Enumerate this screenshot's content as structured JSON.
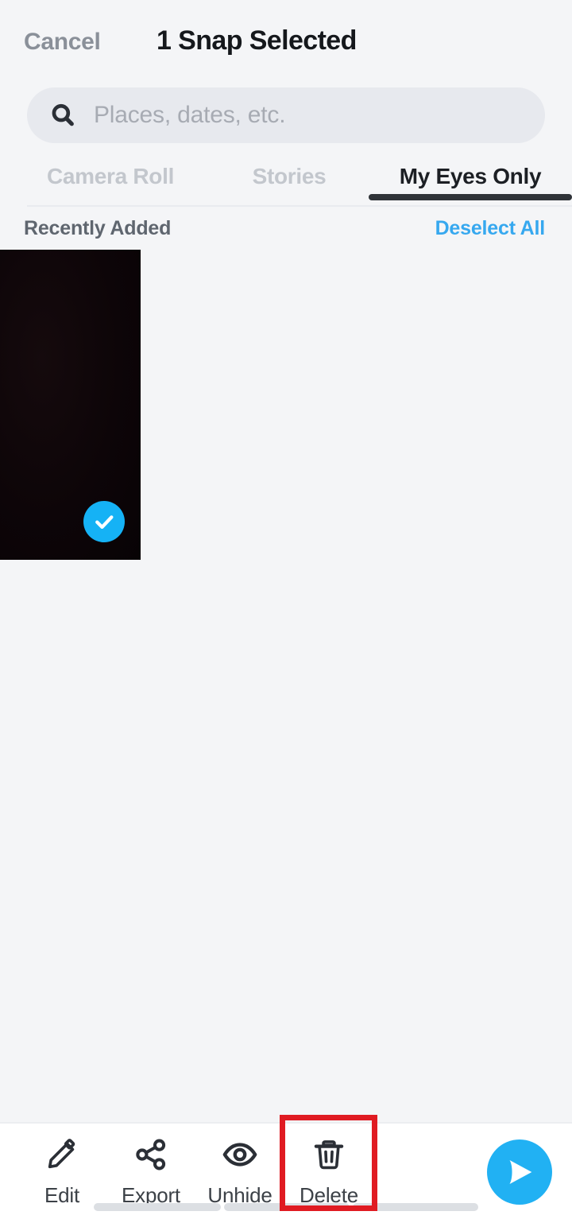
{
  "header": {
    "cancel_label": "Cancel",
    "title": "1 Snap Selected"
  },
  "search": {
    "placeholder": "Places, dates, etc.",
    "value": "",
    "icon": "search-icon"
  },
  "tabs": [
    {
      "label": "Camera Roll",
      "active": false
    },
    {
      "label": "Stories",
      "active": false
    },
    {
      "label": "My Eyes Only",
      "active": true
    }
  ],
  "section": {
    "title": "Recently Added",
    "action_label": "Deselect All"
  },
  "gallery": {
    "items": [
      {
        "name": "snap-thumbnail",
        "selected": true,
        "badge_icon": "check-icon"
      }
    ]
  },
  "toolbar": {
    "items": [
      {
        "label": "Edit",
        "icon": "pencil-icon"
      },
      {
        "label": "Export",
        "icon": "share-icon"
      },
      {
        "label": "Unhide",
        "icon": "eye-icon"
      },
      {
        "label": "Delete",
        "icon": "trash-icon"
      }
    ],
    "send": {
      "icon": "send-arrow-icon"
    }
  },
  "colors": {
    "page_background": "#f4f5f7",
    "accent_blue": "#21b1f3",
    "link_blue": "#36a8ef",
    "highlight_red": "#e01b22",
    "text_dark": "#15181c",
    "text_muted": "#8a9099"
  }
}
